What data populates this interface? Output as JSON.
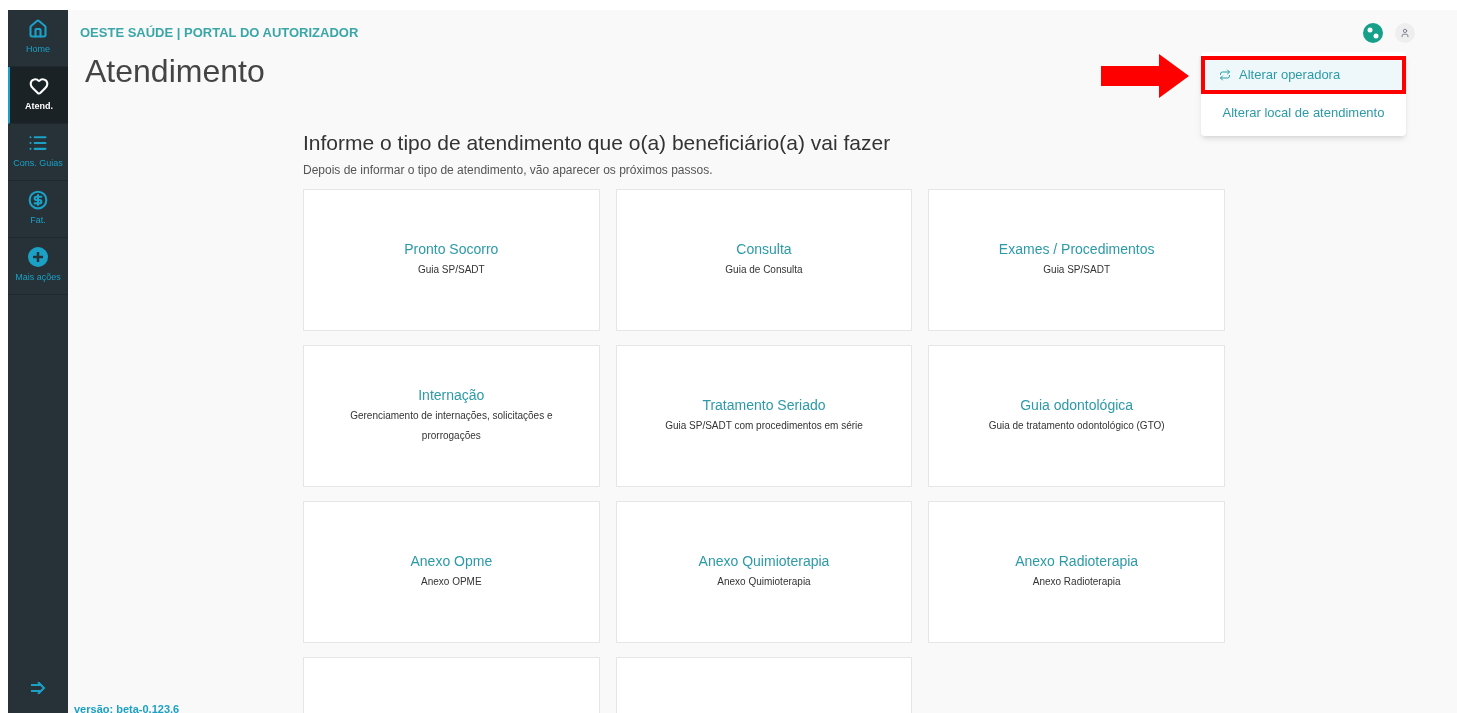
{
  "sidebar": {
    "items": [
      {
        "kind": "home",
        "label": "Home",
        "selected": false
      },
      {
        "kind": "heart",
        "label": "Atend.",
        "selected": true
      },
      {
        "kind": "list",
        "label": "Cons. Guias",
        "selected": false
      },
      {
        "kind": "money",
        "label": "Fat.",
        "selected": false
      },
      {
        "kind": "plus",
        "label": "Mais ações",
        "selected": false
      }
    ]
  },
  "header": {
    "brand": "OESTE SAÚDE | PORTAL DO AUTORIZADOR"
  },
  "page_title": "Atendimento",
  "section": {
    "heading": "Informe o tipo de atendimento que o(a) beneficiário(a) vai fazer",
    "subheading": "Depois de informar o tipo de atendimento, vão aparecer os próximos passos."
  },
  "cards": [
    {
      "kind": "service",
      "title": "Pronto Socorro",
      "subtitle": "Guia SP/SADT"
    },
    {
      "kind": "service",
      "title": "Consulta",
      "subtitle": "Guia de Consulta"
    },
    {
      "kind": "service",
      "title": "Exames / Procedimentos",
      "subtitle": "Guia SP/SADT"
    },
    {
      "kind": "service",
      "title": "Internação",
      "subtitle": "Gerenciamento de internações, solicitações e prorrogações"
    },
    {
      "kind": "service",
      "title": "Tratamento Seriado",
      "subtitle": "Guia SP/SADT com procedimentos em série"
    },
    {
      "kind": "service",
      "title": "Guia odontológica",
      "subtitle": "Guia de tratamento odontológico (GTO)"
    },
    {
      "kind": "service",
      "title": "Anexo Opme",
      "subtitle": "Anexo OPME"
    },
    {
      "kind": "service",
      "title": "Anexo Quimioterapia",
      "subtitle": "Anexo Quimioterapia"
    },
    {
      "kind": "service",
      "title": "Anexo Radioterapia",
      "subtitle": "Anexo Radioterapia"
    },
    {
      "kind": "blank"
    },
    {
      "kind": "blank"
    }
  ],
  "menu": {
    "items": [
      {
        "label": "Alterar operadora",
        "icon": true,
        "selected": true,
        "highlighted": true
      },
      {
        "label": "Alterar local de atendimento",
        "icon": false,
        "selected": false,
        "highlighted": false
      }
    ]
  },
  "version": "versão: beta-0.123.6"
}
